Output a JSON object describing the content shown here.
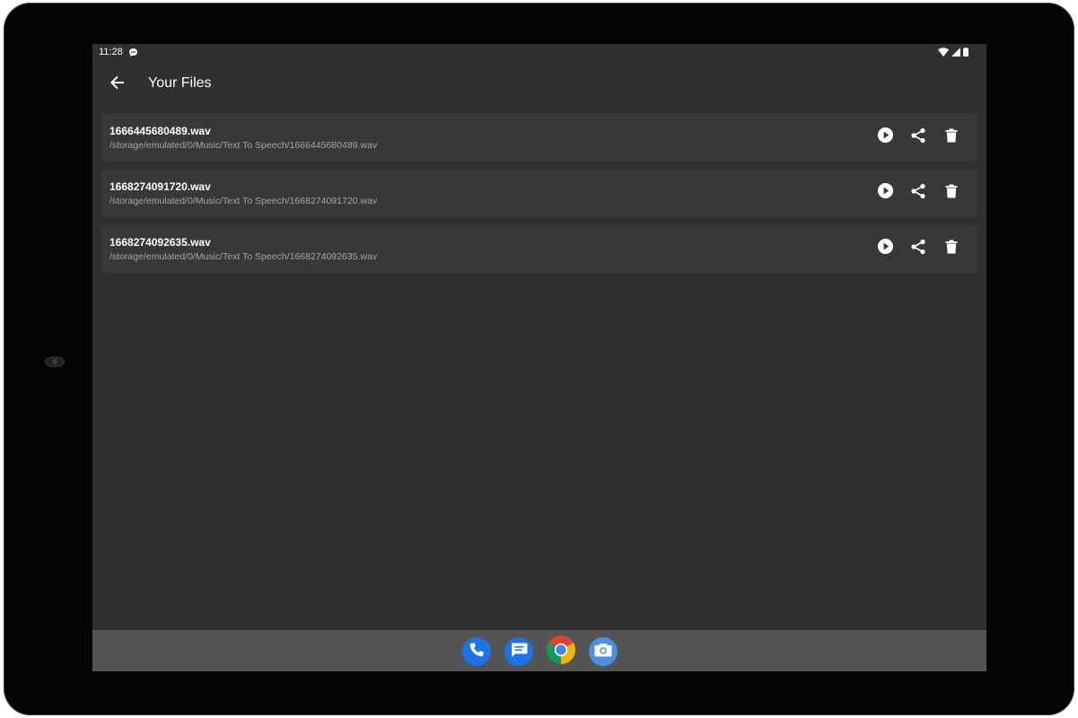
{
  "status_bar": {
    "time": "11:28",
    "icons": [
      "chat-notification-icon",
      "wifi-icon",
      "signal-icon",
      "battery-icon"
    ]
  },
  "app_bar": {
    "title": "Your Files",
    "back_icon": "arrow-back-icon"
  },
  "files": [
    {
      "name": "1666445680489.wav",
      "path": "/storage/emulated/0/Music/Text To Speech/1666445680489.wav"
    },
    {
      "name": "1668274091720.wav",
      "path": "/storage/emulated/0/Music/Text To Speech/1668274091720.wav"
    },
    {
      "name": "1668274092635.wav",
      "path": "/storage/emulated/0/Music/Text To Speech/1668274092635.wav"
    }
  ],
  "file_actions": [
    "play-icon",
    "share-icon",
    "delete-icon"
  ],
  "dock": {
    "apps": [
      "phone-icon",
      "messages-icon",
      "chrome-icon",
      "camera-icon"
    ]
  },
  "colors": {
    "background": "#303030",
    "card": "#383838",
    "navbar": "#545454",
    "text_primary": "#ffffff",
    "text_secondary": "#a6a6a6",
    "accent_blue": "#1a73e8"
  }
}
